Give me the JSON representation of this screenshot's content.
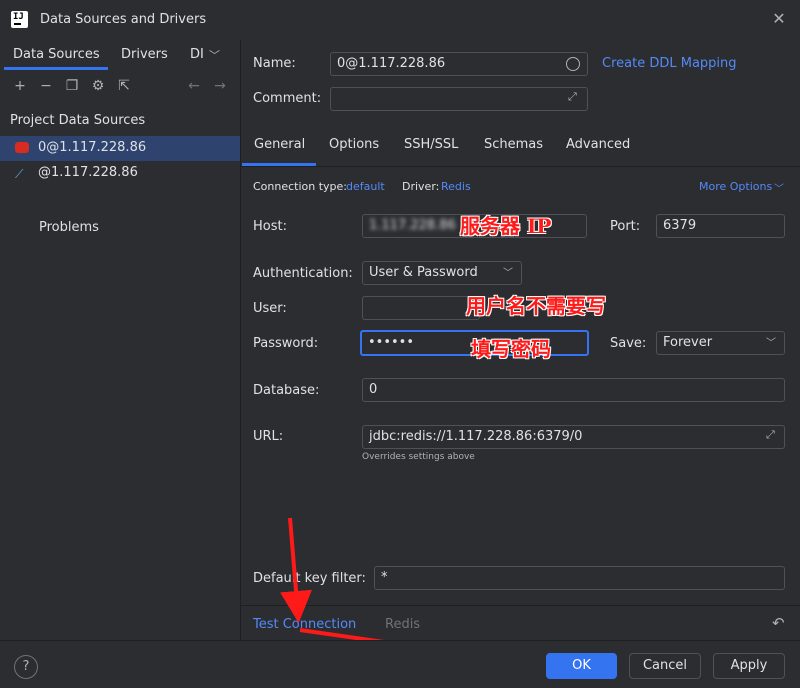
{
  "window": {
    "title": "Data Sources and Drivers",
    "app_icon": "IJ",
    "close": "✕"
  },
  "left": {
    "tabs": [
      "Data Sources",
      "Drivers",
      "DI"
    ],
    "section": "Project Data Sources",
    "items": [
      "0@1.117.228.86",
      "@1.117.228.86"
    ],
    "problems": "Problems"
  },
  "form": {
    "name_label": "Name:",
    "name_value": "0@1.117.228.86",
    "create_ddl": "Create DDL Mapping",
    "comment_label": "Comment:",
    "tabs": [
      "General",
      "Options",
      "SSH/SSL",
      "Schemas",
      "Advanced"
    ],
    "conn_type_label": "Connection type:",
    "conn_type_value": "default",
    "driver_label": "Driver:",
    "driver_value": "Redis",
    "more_options": "More Options",
    "host_label": "Host:",
    "host_value": "1.117.228.86",
    "port_label": "Port:",
    "port_value": "6379",
    "auth_label": "Authentication:",
    "auth_value": "User & Password",
    "user_label": "User:",
    "password_label": "Password:",
    "password_value": "••••••",
    "save_label": "Save:",
    "save_value": "Forever",
    "database_label": "Database:",
    "database_value": "0",
    "url_label": "URL:",
    "url_value": "jdbc:redis://1.117.228.86:6379/0",
    "url_hint": "Overrides settings above",
    "key_filter_label": "Default key filter:",
    "key_filter_value": "*",
    "test_connection": "Test Connection",
    "driver_link": "Redis"
  },
  "annotations": {
    "host": "服务器 IP",
    "user": "用户名不需要写",
    "password": "填写密码"
  },
  "buttons": {
    "help": "?",
    "ok": "OK",
    "cancel": "Cancel",
    "apply": "Apply"
  },
  "colors": {
    "accent": "#3574f0",
    "link": "#548af7",
    "annotation": "#ff1a1a"
  }
}
